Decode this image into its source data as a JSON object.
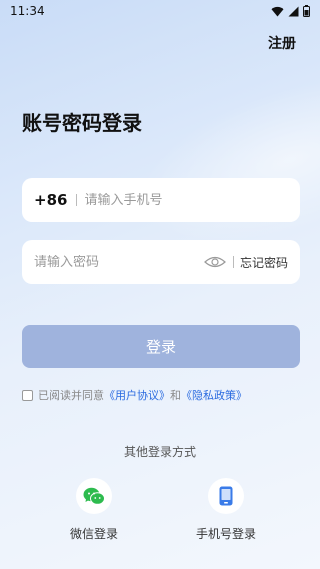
{
  "status_bar": {
    "time": "11:34",
    "icons": [
      "wifi-icon",
      "signal-icon",
      "battery-icon"
    ]
  },
  "header": {
    "register_label": "注册"
  },
  "page": {
    "title": "账号密码登录"
  },
  "phone_field": {
    "prefix": "+86",
    "value": "",
    "placeholder": "请输入手机号"
  },
  "password_field": {
    "value": "",
    "placeholder": "请输入密码",
    "forgot_label": "忘记密码",
    "toggle_icon": "eye-icon"
  },
  "login_button": {
    "label": "登录"
  },
  "agreement": {
    "prefix_text": "已阅读并同意",
    "user_agreement": "《用户协议》",
    "and_text": "和",
    "privacy_policy": "《隐私政策》",
    "checked": false
  },
  "other_login": {
    "title": "其他登录方式",
    "options": [
      {
        "label": "微信登录",
        "icon": "wechat-icon"
      },
      {
        "label": "手机号登录",
        "icon": "phone-icon"
      }
    ]
  },
  "colors": {
    "accent_link": "#2b6be0",
    "login_button_bg": "#9fb3dd",
    "wechat_green": "#2dbb4e",
    "phone_blue": "#3a7be8"
  }
}
